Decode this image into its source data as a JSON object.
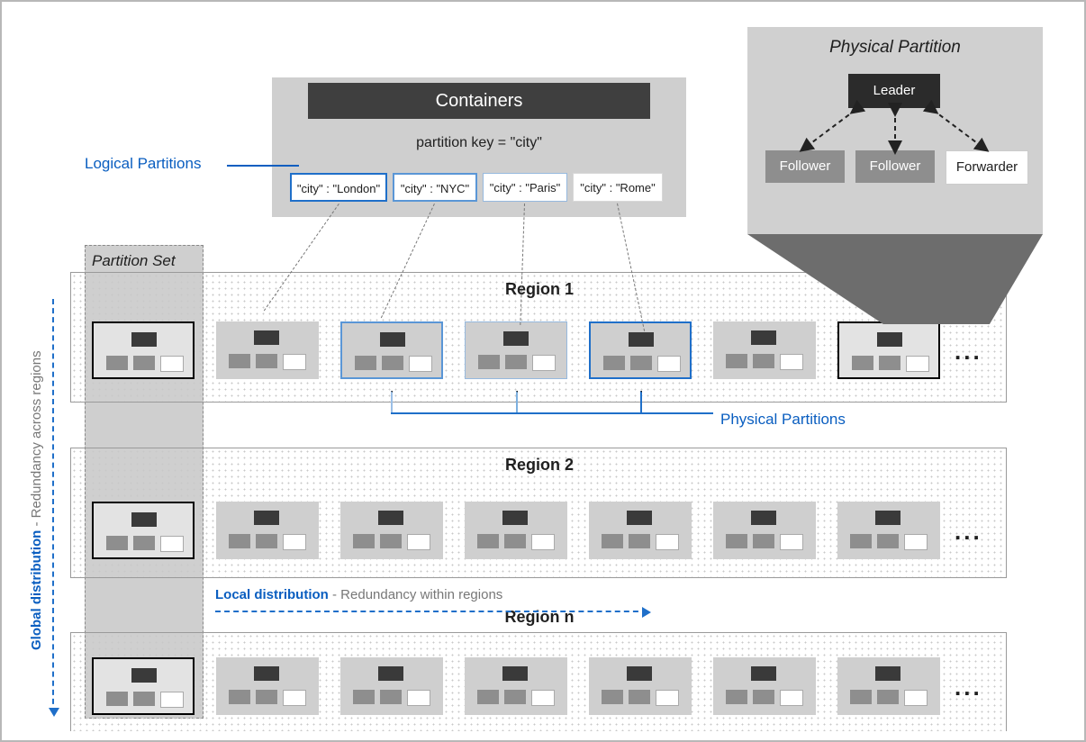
{
  "container": {
    "title": "Containers",
    "partition_key": "partition key = \"city\"",
    "cities": {
      "c1": "\"city\" : \"London\"",
      "c2": "\"city\" : \"NYC\"",
      "c3": "\"city\" : \"Paris\"",
      "c4": "\"city\" : \"Rome\""
    }
  },
  "labels": {
    "logical_partitions": "Logical Partitions",
    "partition_set": "Partition Set",
    "physical_partitions": "Physical Partitions",
    "ellipsis": "..."
  },
  "regions": {
    "r1": "Region 1",
    "r2": "Region 2",
    "rn": "Region n"
  },
  "pp": {
    "title": "Physical Partition",
    "leader": "Leader",
    "follower": "Follower",
    "forwarder": "Forwarder"
  },
  "distribution": {
    "local_b": "Local distribution",
    "local_t": "  -  Redundancy within regions",
    "global_b": "Global distribution",
    "global_t": "  -  Redundancy across regions"
  }
}
